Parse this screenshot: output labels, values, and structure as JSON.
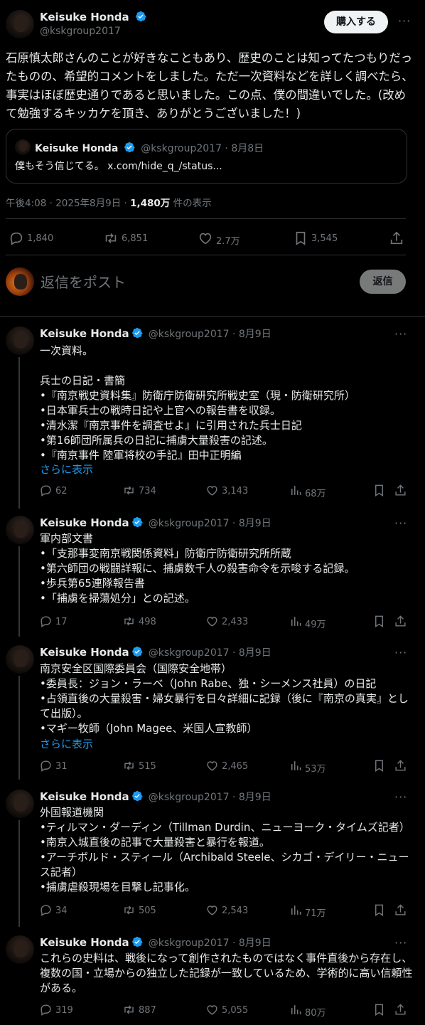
{
  "main": {
    "author": {
      "name": "Keisuke Honda",
      "handle": "@kskgroup2017"
    },
    "buy_button": "購入する",
    "more": "···",
    "text": "石原慎太郎さんのことが好きなこともあり、歴史のことは知ってたつもりだったものの、希望的コメントをしました。ただ一次資料などを詳しく調べたら、事実はほぼ歴史通りであると思いました。この点、僕の間違いでした。(改めて勉強するキッカケを頂き、ありがとうございました！)",
    "quote": {
      "name": "Keisuke Honda",
      "meta": "@kskgroup2017 · 8月8日",
      "text": "僕もそう信じてる。 x.com/hide_q_/status..."
    },
    "timestamp": "午後4:08 · 2025年8月9日 · ",
    "views_count": "1,480万",
    "views_label": " 件の表示",
    "stats": {
      "replies": "1,840",
      "reposts": "6,851",
      "likes": "2.7万",
      "bookmarks": "3,545"
    }
  },
  "reply_box": {
    "placeholder": "返信をポスト",
    "button": "返信"
  },
  "thread": [
    {
      "name": "Keisuke Honda",
      "meta": "@kskgroup2017 · 8月9日",
      "text": "一次資料。\n\n兵士の日記・書簡\n•『南京戦史資料集』防衛庁防衛研究所戦史室（現・防衛研究所）\n•日本軍兵士の戦時日記や上官への報告書を収録。\n•清水潔『南京事件を調査せよ』に引用された兵士日記\n•第16師団所属兵の日記に捕虜大量殺害の記述。\n•『南京事件 陸軍将校の手記』田中正明編",
      "show_more": "さらに表示",
      "replies": "62",
      "reposts": "734",
      "likes": "3,143",
      "views": "68万"
    },
    {
      "name": "Keisuke Honda",
      "meta": "@kskgroup2017 · 8月9日",
      "text": "軍内部文書\n•「支那事変南京戦関係資料」防衛庁防衛研究所所蔵\n•第六師団の戦闘詳報に、捕虜数千人の殺害命令を示唆する記録。\n•歩兵第65連隊報告書\n•「捕虜を掃蕩処分」との記述。",
      "show_more": "",
      "replies": "17",
      "reposts": "498",
      "likes": "2,433",
      "views": "49万"
    },
    {
      "name": "Keisuke Honda",
      "meta": "@kskgroup2017 · 8月9日",
      "text": "南京安全区国際委員会（国際安全地帯）\n•委員長：ジョン・ラーベ（John Rabe、独・シーメンス社員）の日記\n•占領直後の大量殺害・婦女暴行を日々詳細に記録（後に『南京の真実』として出版）。\n•マギー牧師（John Magee、米国人宣教師）",
      "show_more": "さらに表示",
      "replies": "31",
      "reposts": "515",
      "likes": "2,465",
      "views": "53万"
    },
    {
      "name": "Keisuke Honda",
      "meta": "@kskgroup2017 · 8月9日",
      "text": "外国報道機関\n•ティルマン・ダーディン（Tillman Durdin、ニューヨーク・タイムズ記者）\n•南京入城直後の記事で大量殺害と暴行を報道。\n•アーチボルド・スティール（Archibald Steele、シカゴ・デイリー・ニュース記者）\n•捕虜虐殺現場を目撃し記事化。",
      "show_more": "",
      "replies": "34",
      "reposts": "505",
      "likes": "2,543",
      "views": "71万"
    },
    {
      "name": "Keisuke Honda",
      "meta": "@kskgroup2017 · 8月9日",
      "text": "これらの史料は、戦後になって創作されたものではなく事件直後から存在し、複数の国・立場からの独立した記録が一致しているため、学術的に高い信頼性がある。",
      "show_more": "",
      "replies": "319",
      "reposts": "887",
      "likes": "5,055",
      "views": "80万"
    }
  ],
  "icons": {
    "verified": "verified-badge-icon",
    "reply": "reply-icon",
    "repost": "repost-icon",
    "like": "heart-icon",
    "views": "views-icon",
    "bookmark": "bookmark-icon",
    "share": "share-icon"
  },
  "colors": {
    "background": "#000000",
    "accent": "#1d9bf0",
    "text": "#e7e9ea",
    "muted": "#71767b",
    "border": "#2f3336"
  }
}
